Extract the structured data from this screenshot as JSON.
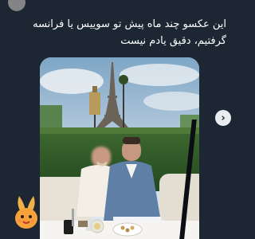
{
  "post": {
    "text": "این عکسو چند ماه پیش تو سوییس یا فرانسه گرفتیم، دقیق یادم نیست"
  },
  "media": {
    "next_icon": "chevron-right-icon",
    "next_glyph": "›"
  },
  "sticker": {
    "icon": "bunny-sticker-icon"
  },
  "colors": {
    "background": "#1c2733",
    "text": "#ffffff",
    "button_bg": "#e9ecef"
  }
}
